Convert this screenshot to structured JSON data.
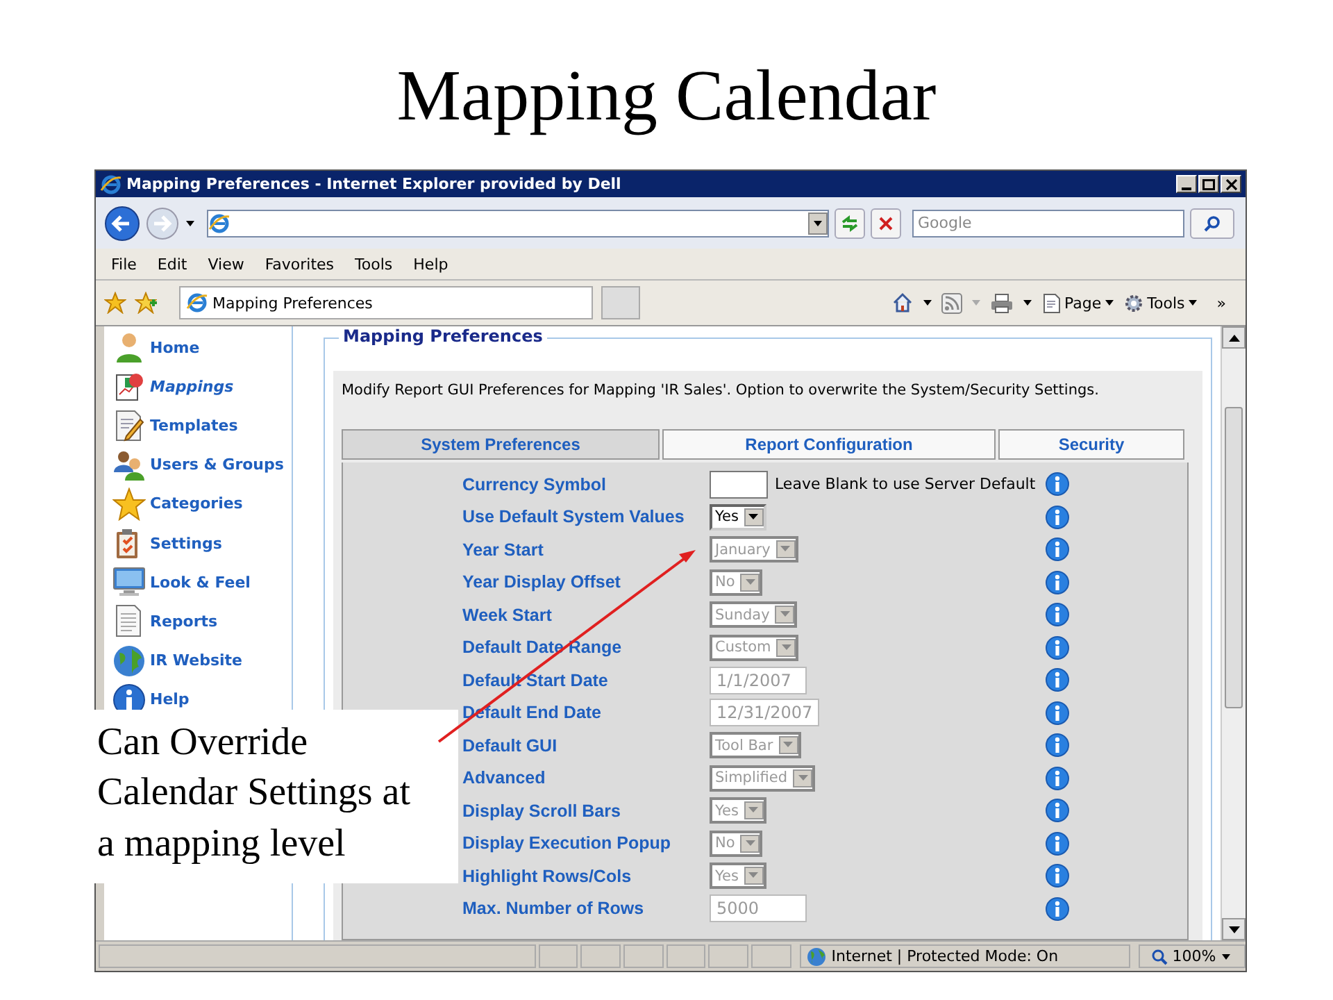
{
  "slide_title": "Mapping Calendar",
  "window": {
    "title": "Mapping Preferences - Internet Explorer provided by Dell"
  },
  "search": {
    "placeholder": "Google"
  },
  "menu": [
    "File",
    "Edit",
    "View",
    "Favorites",
    "Tools",
    "Help"
  ],
  "browser_tab": {
    "label": "Mapping Preferences"
  },
  "command_bar": {
    "page": "Page",
    "tools": "Tools",
    "more": "»"
  },
  "sidebar": {
    "items": [
      {
        "label": "Home",
        "kind": "home",
        "selected": false
      },
      {
        "label": "Mappings",
        "kind": "mappings",
        "selected": true
      },
      {
        "label": "Templates",
        "kind": "templates",
        "selected": false
      },
      {
        "label": "Users & Groups",
        "kind": "users",
        "selected": false
      },
      {
        "label": "Categories",
        "kind": "categories",
        "selected": false
      },
      {
        "label": "Settings",
        "kind": "settings",
        "selected": false
      },
      {
        "label": "Look & Feel",
        "kind": "look",
        "selected": false
      },
      {
        "label": "Reports",
        "kind": "reports",
        "selected": false
      },
      {
        "label": "IR Website",
        "kind": "website",
        "selected": false
      },
      {
        "label": "Help",
        "kind": "help",
        "selected": false
      }
    ]
  },
  "panel": {
    "legend": "Mapping Preferences",
    "description": "Modify Report GUI Preferences for Mapping 'IR Sales'. Option to overwrite the System/Security Settings.",
    "tabs": [
      {
        "label": "System Preferences",
        "selected": true
      },
      {
        "label": "Report Configuration",
        "selected": false
      },
      {
        "label": "Security",
        "selected": false
      }
    ],
    "rows": [
      {
        "label": "Currency Symbol",
        "kind": "text",
        "disabled": false,
        "note": "Leave Blank to use Server Default"
      },
      {
        "label": "Use Default System Values",
        "kind": "select",
        "value": "Yes",
        "disabled": false
      },
      {
        "label": "Year Start",
        "kind": "select",
        "value": "January",
        "disabled": true
      },
      {
        "label": "Year Display Offset",
        "kind": "select",
        "value": "No",
        "disabled": true
      },
      {
        "label": "Week Start",
        "kind": "select",
        "value": "Sunday",
        "disabled": true
      },
      {
        "label": "Default Date Range",
        "kind": "select",
        "value": "Custom",
        "disabled": true
      },
      {
        "label": "Default Start Date",
        "kind": "text",
        "value": "1/1/2007",
        "disabled": true
      },
      {
        "label": "Default End Date",
        "kind": "text",
        "value": "12/31/2007",
        "disabled": true
      },
      {
        "label": "Default GUI",
        "kind": "select",
        "value": "Tool Bar",
        "disabled": true
      },
      {
        "label": "Advanced",
        "kind": "select",
        "value": "Simplified",
        "disabled": true
      },
      {
        "label": "Display Scroll Bars",
        "kind": "select",
        "value": "Yes",
        "disabled": true
      },
      {
        "label": "Display Execution Popup",
        "kind": "select",
        "value": "No",
        "disabled": true
      },
      {
        "label": "Highlight Rows/Cols",
        "kind": "select",
        "value": "Yes",
        "disabled": true
      },
      {
        "label": "Max. Number of Rows",
        "kind": "text",
        "value": "5000",
        "disabled": true
      }
    ]
  },
  "status_bar": {
    "zone": "Internet | Protected Mode: On",
    "zoom": "100%"
  },
  "callout": {
    "text": "Can Override Calendar Settings at a mapping level"
  }
}
